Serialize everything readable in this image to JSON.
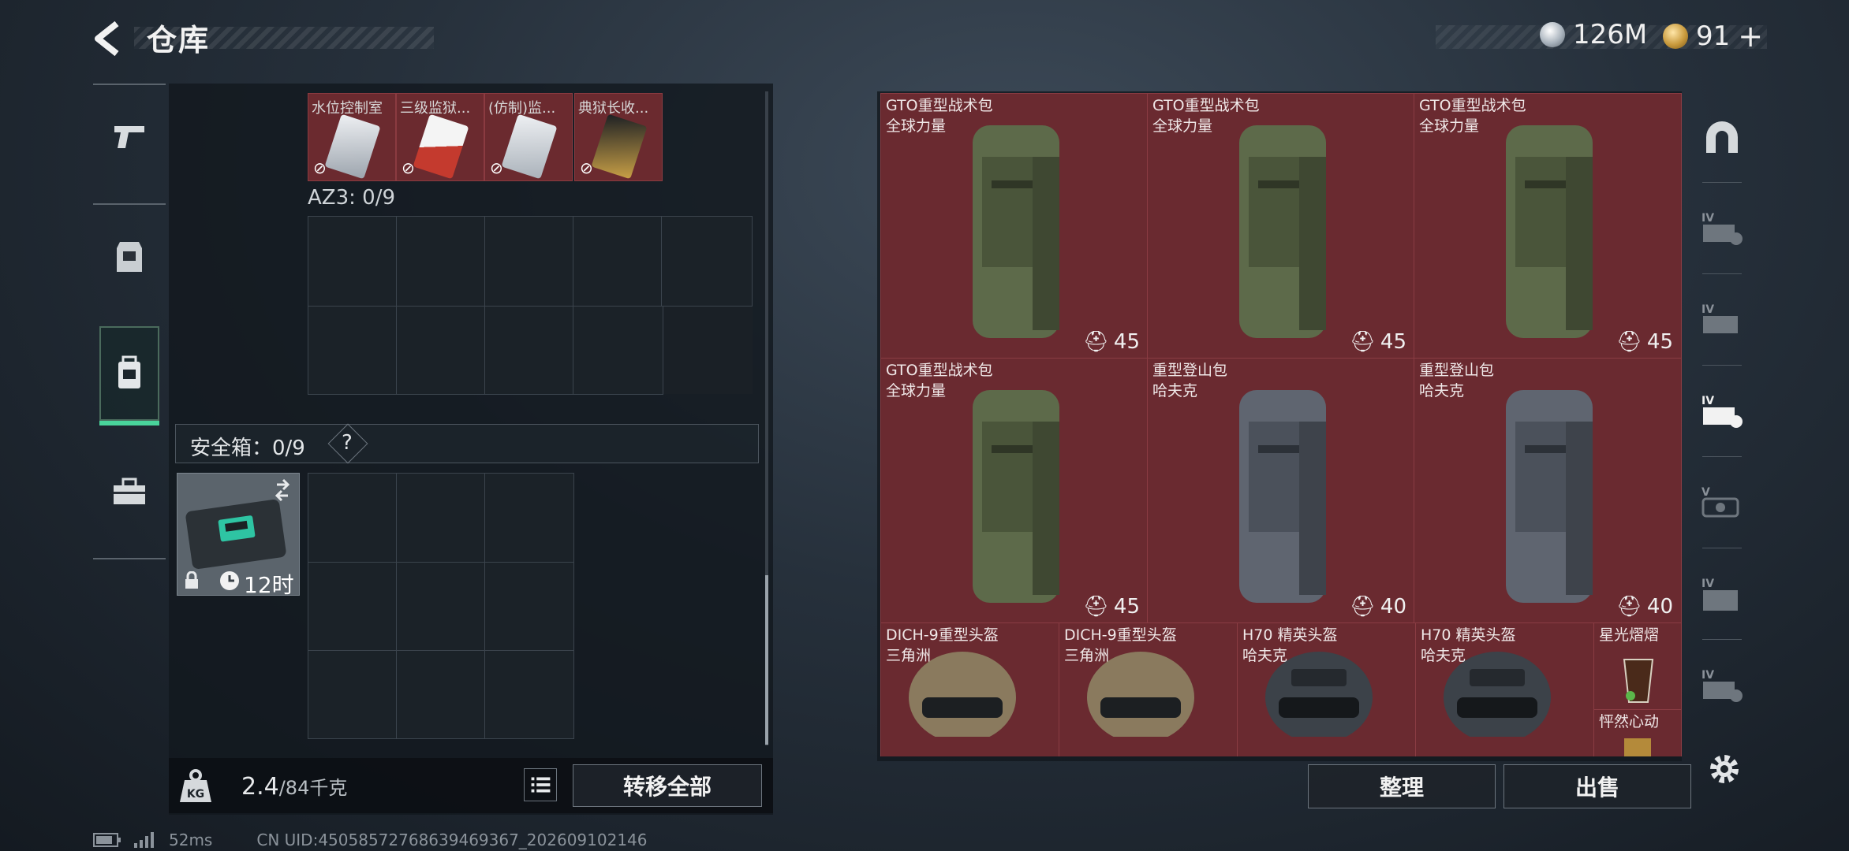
{
  "header": {
    "title": "仓库",
    "currency_silver": "126M",
    "currency_gold": "91",
    "add_symbol": "+"
  },
  "left_nav": {
    "items": [
      {
        "icon": "pistol-icon"
      },
      {
        "icon": "armor-vest-icon"
      },
      {
        "icon": "backpack-icon",
        "active": true
      },
      {
        "icon": "toolbox-icon"
      }
    ]
  },
  "container": {
    "items": [
      {
        "label": "水位控制室",
        "card_color": "#d9dde2"
      },
      {
        "label": "三级监狱...",
        "card_color": "#c43a2e"
      },
      {
        "label": "(仿制)监...",
        "card_color": "#d0d4d8"
      },
      {
        "label": "典狱长收...",
        "card_color": "#c9a046"
      }
    ],
    "az3_label": "AZ3: 0/9",
    "safe_label": "安全箱：0/9",
    "help": "?",
    "safe_timer": "12时",
    "weight_current": "2.4",
    "weight_max": "/84千克",
    "transfer_all": "转移全部"
  },
  "stash": {
    "items": [
      {
        "name": "GTO重型战术包",
        "maker": "全球力量",
        "capacity": "45",
        "kind": "bag",
        "tint": "#5d6a4a"
      },
      {
        "name": "GTO重型战术包",
        "maker": "全球力量",
        "capacity": "45",
        "kind": "bag",
        "tint": "#5d6a4a"
      },
      {
        "name": "GTO重型战术包",
        "maker": "全球力量",
        "capacity": "45",
        "kind": "bag",
        "tint": "#5d6a4a"
      },
      {
        "name": "GTO重型战术包",
        "maker": "全球力量",
        "capacity": "45",
        "kind": "bag",
        "tint": "#5d6a4a"
      },
      {
        "name": "重型登山包",
        "maker": "哈夫克",
        "capacity": "40",
        "kind": "bag",
        "tint": "#5f6570"
      },
      {
        "name": "重型登山包",
        "maker": "哈夫克",
        "capacity": "40",
        "kind": "bag",
        "tint": "#5f6570"
      },
      {
        "name": "DICH-9重型头盔",
        "maker": "三角洲",
        "kind": "helmet",
        "tint": "#8a7a5e"
      },
      {
        "name": "DICH-9重型头盔",
        "maker": "三角洲",
        "kind": "helmet",
        "tint": "#8a7a5e"
      },
      {
        "name": "H70 精英头盔",
        "maker": "哈夫克",
        "kind": "helmet",
        "tint": "#3c4249"
      },
      {
        "name": "H70 精英头盔",
        "maker": "哈夫克",
        "kind": "helmet",
        "tint": "#3c4249"
      },
      {
        "name": "星光熠熠",
        "kind": "drink"
      },
      {
        "name": "怦然心动",
        "kind": "small"
      }
    ],
    "sort": "整理",
    "sell": "出售"
  },
  "right_sidebar": {
    "items": [
      {
        "icon": "all-items-icon"
      },
      {
        "icon": "tier-iv-filter-icon"
      },
      {
        "icon": "tier-iv-filter-icon"
      },
      {
        "icon": "tier-iv-filter-icon",
        "active": true
      },
      {
        "icon": "tier-v-filter-icon"
      },
      {
        "icon": "tier-iv-filter-icon"
      },
      {
        "icon": "tier-iv-filter-icon"
      }
    ]
  },
  "status_bar": {
    "ping": "52ms",
    "uid": "CN UID:4505857276863946936​7_202609102146"
  },
  "colors": {
    "accent_green": "#49d49b",
    "item_bg": "#6a2a30",
    "panel_bg": "#12181e"
  }
}
